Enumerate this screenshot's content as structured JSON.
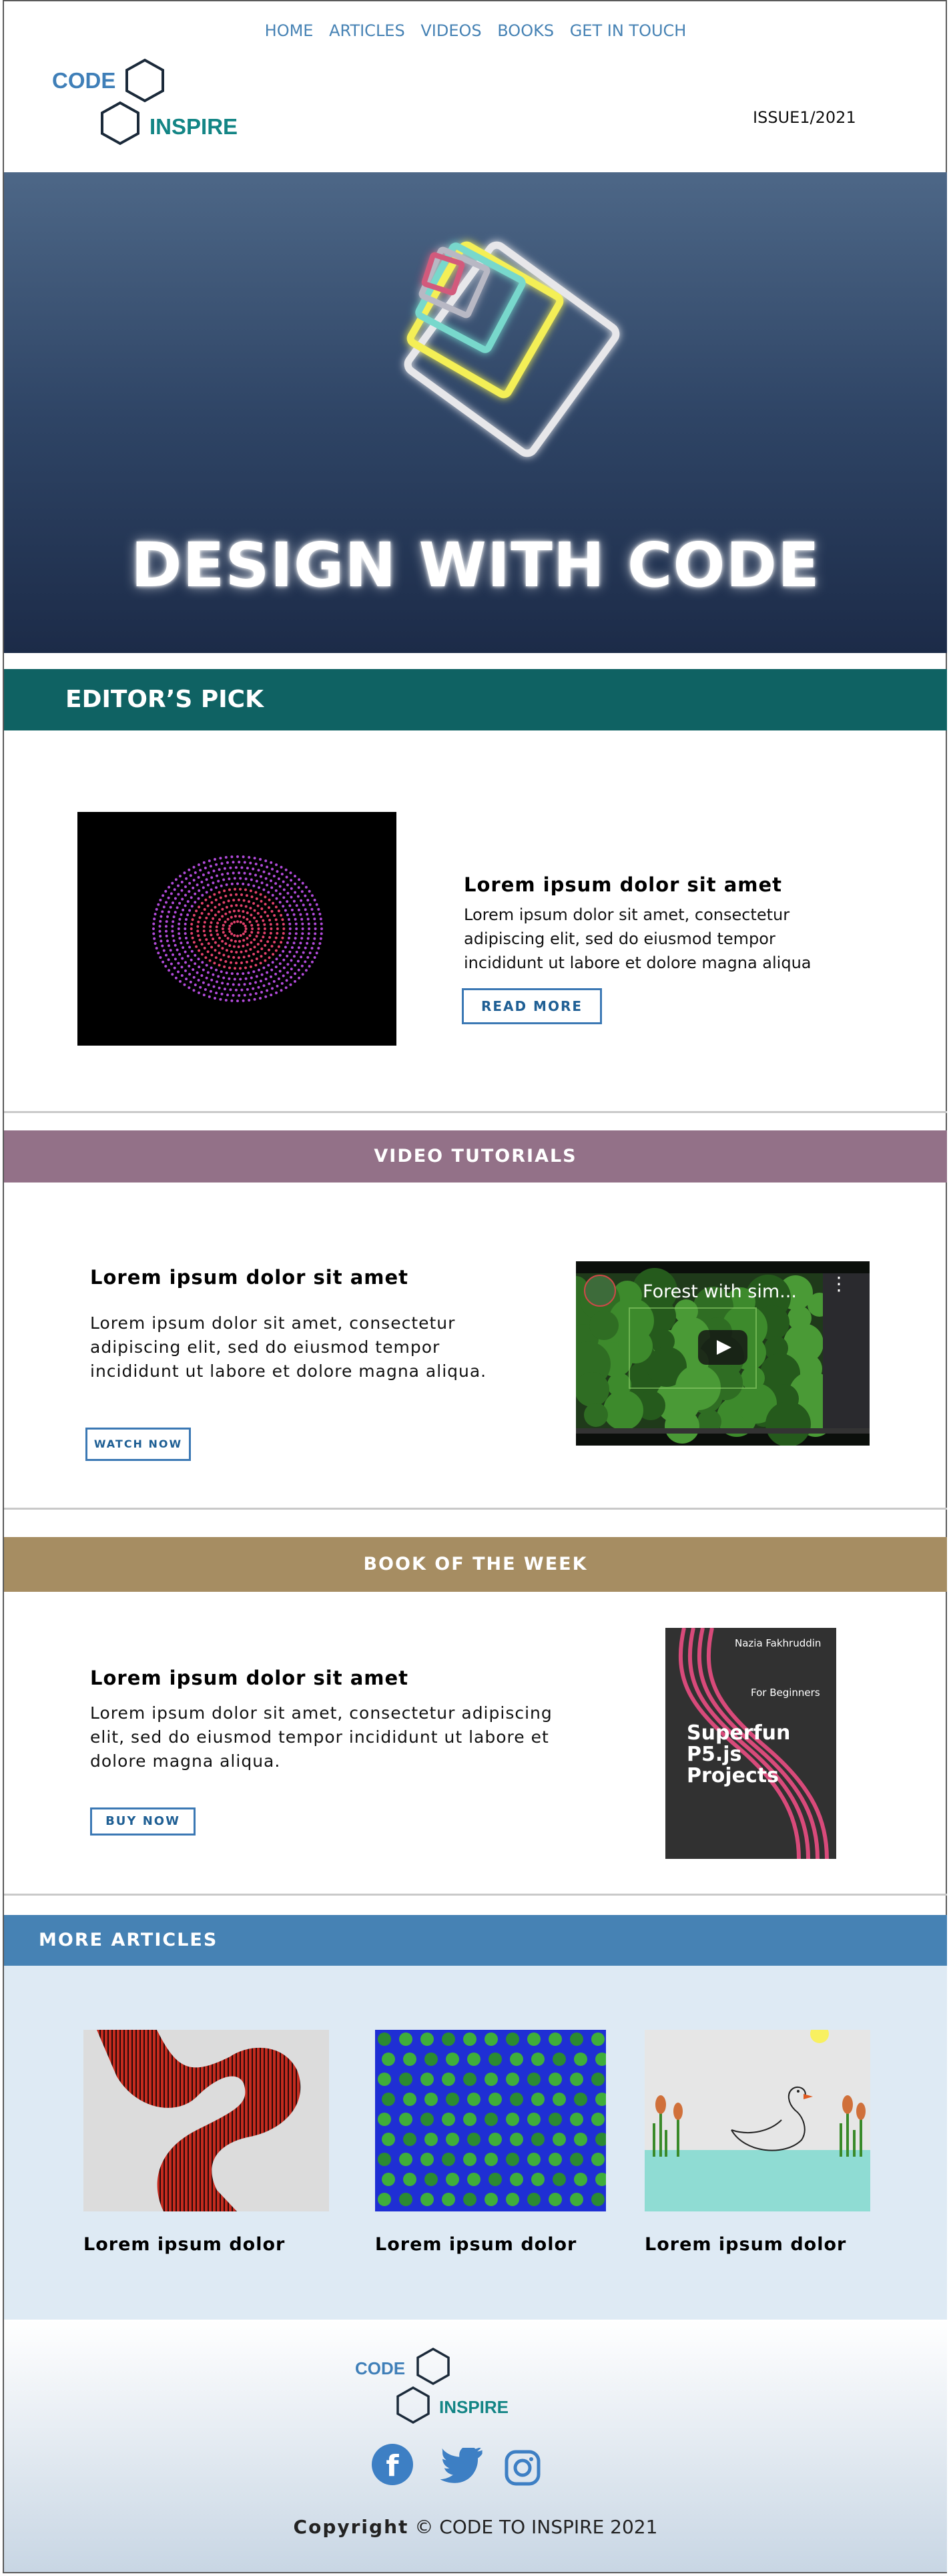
{
  "nav": {
    "items": [
      "HOME",
      "ARTICLES",
      "VIDEOS",
      "BOOKS",
      "GET IN TOUCH"
    ]
  },
  "logo": {
    "word1": "CODE",
    "word2": "INSPIRE"
  },
  "issue": "ISSUE1/2021",
  "hero": {
    "title": "DESIGN WITH CODE"
  },
  "editors_pick": {
    "bar_label": "EDITOR’S  PICK",
    "heading": "Lorem ipsum dolor sit amet",
    "text": "Lorem ipsum dolor sit amet, consectetur adipiscing elit, sed do eiusmod tempor incididunt ut labore et dolore magna aliqua",
    "button": "READ  MORE"
  },
  "video": {
    "bar_label": "VIDEO TUTORIALS",
    "heading": "Lorem ipsum dolor sit amet",
    "text": "Lorem ipsum dolor sit amet, consectetur adipiscing elit, sed do eiusmod tempor incididunt ut labore et dolore magna aliqua.",
    "button": "WATCH  NOW",
    "video_title": "Forest with sim..."
  },
  "book": {
    "bar_label": "BOOK OF THE WEEK",
    "heading": "Lorem ipsum dolor sit amet",
    "text": "Lorem ipsum dolor sit amet, consectetur adipiscing elit, sed do eiusmod tempor incididunt ut labore et dolore magna aliqua.",
    "button": "BUY NOW",
    "cover_author": "Nazia Fakhruddin",
    "cover_sub": "For Beginners",
    "cover_title_1": "Superfun",
    "cover_title_2": "P5.js",
    "cover_title_3": "Projects"
  },
  "more": {
    "bar_label": "MORE  ARTICLES",
    "cards": [
      {
        "title": "Lorem ipsum dolor"
      },
      {
        "title": "Lorem ipsum dolor"
      },
      {
        "title": "Lorem ipsum dolor"
      }
    ]
  },
  "footer": {
    "copyright_label": "Copyright",
    "copyright_symbol": "©",
    "copyright_text": "CODE TO INSPIRE  2021"
  },
  "colors": {
    "editor_bar": "#0f6263",
    "video_bar": "#937188",
    "book_bar": "#a68d62",
    "more_bar": "#4682b4",
    "accent_blue": "#4682b4"
  }
}
